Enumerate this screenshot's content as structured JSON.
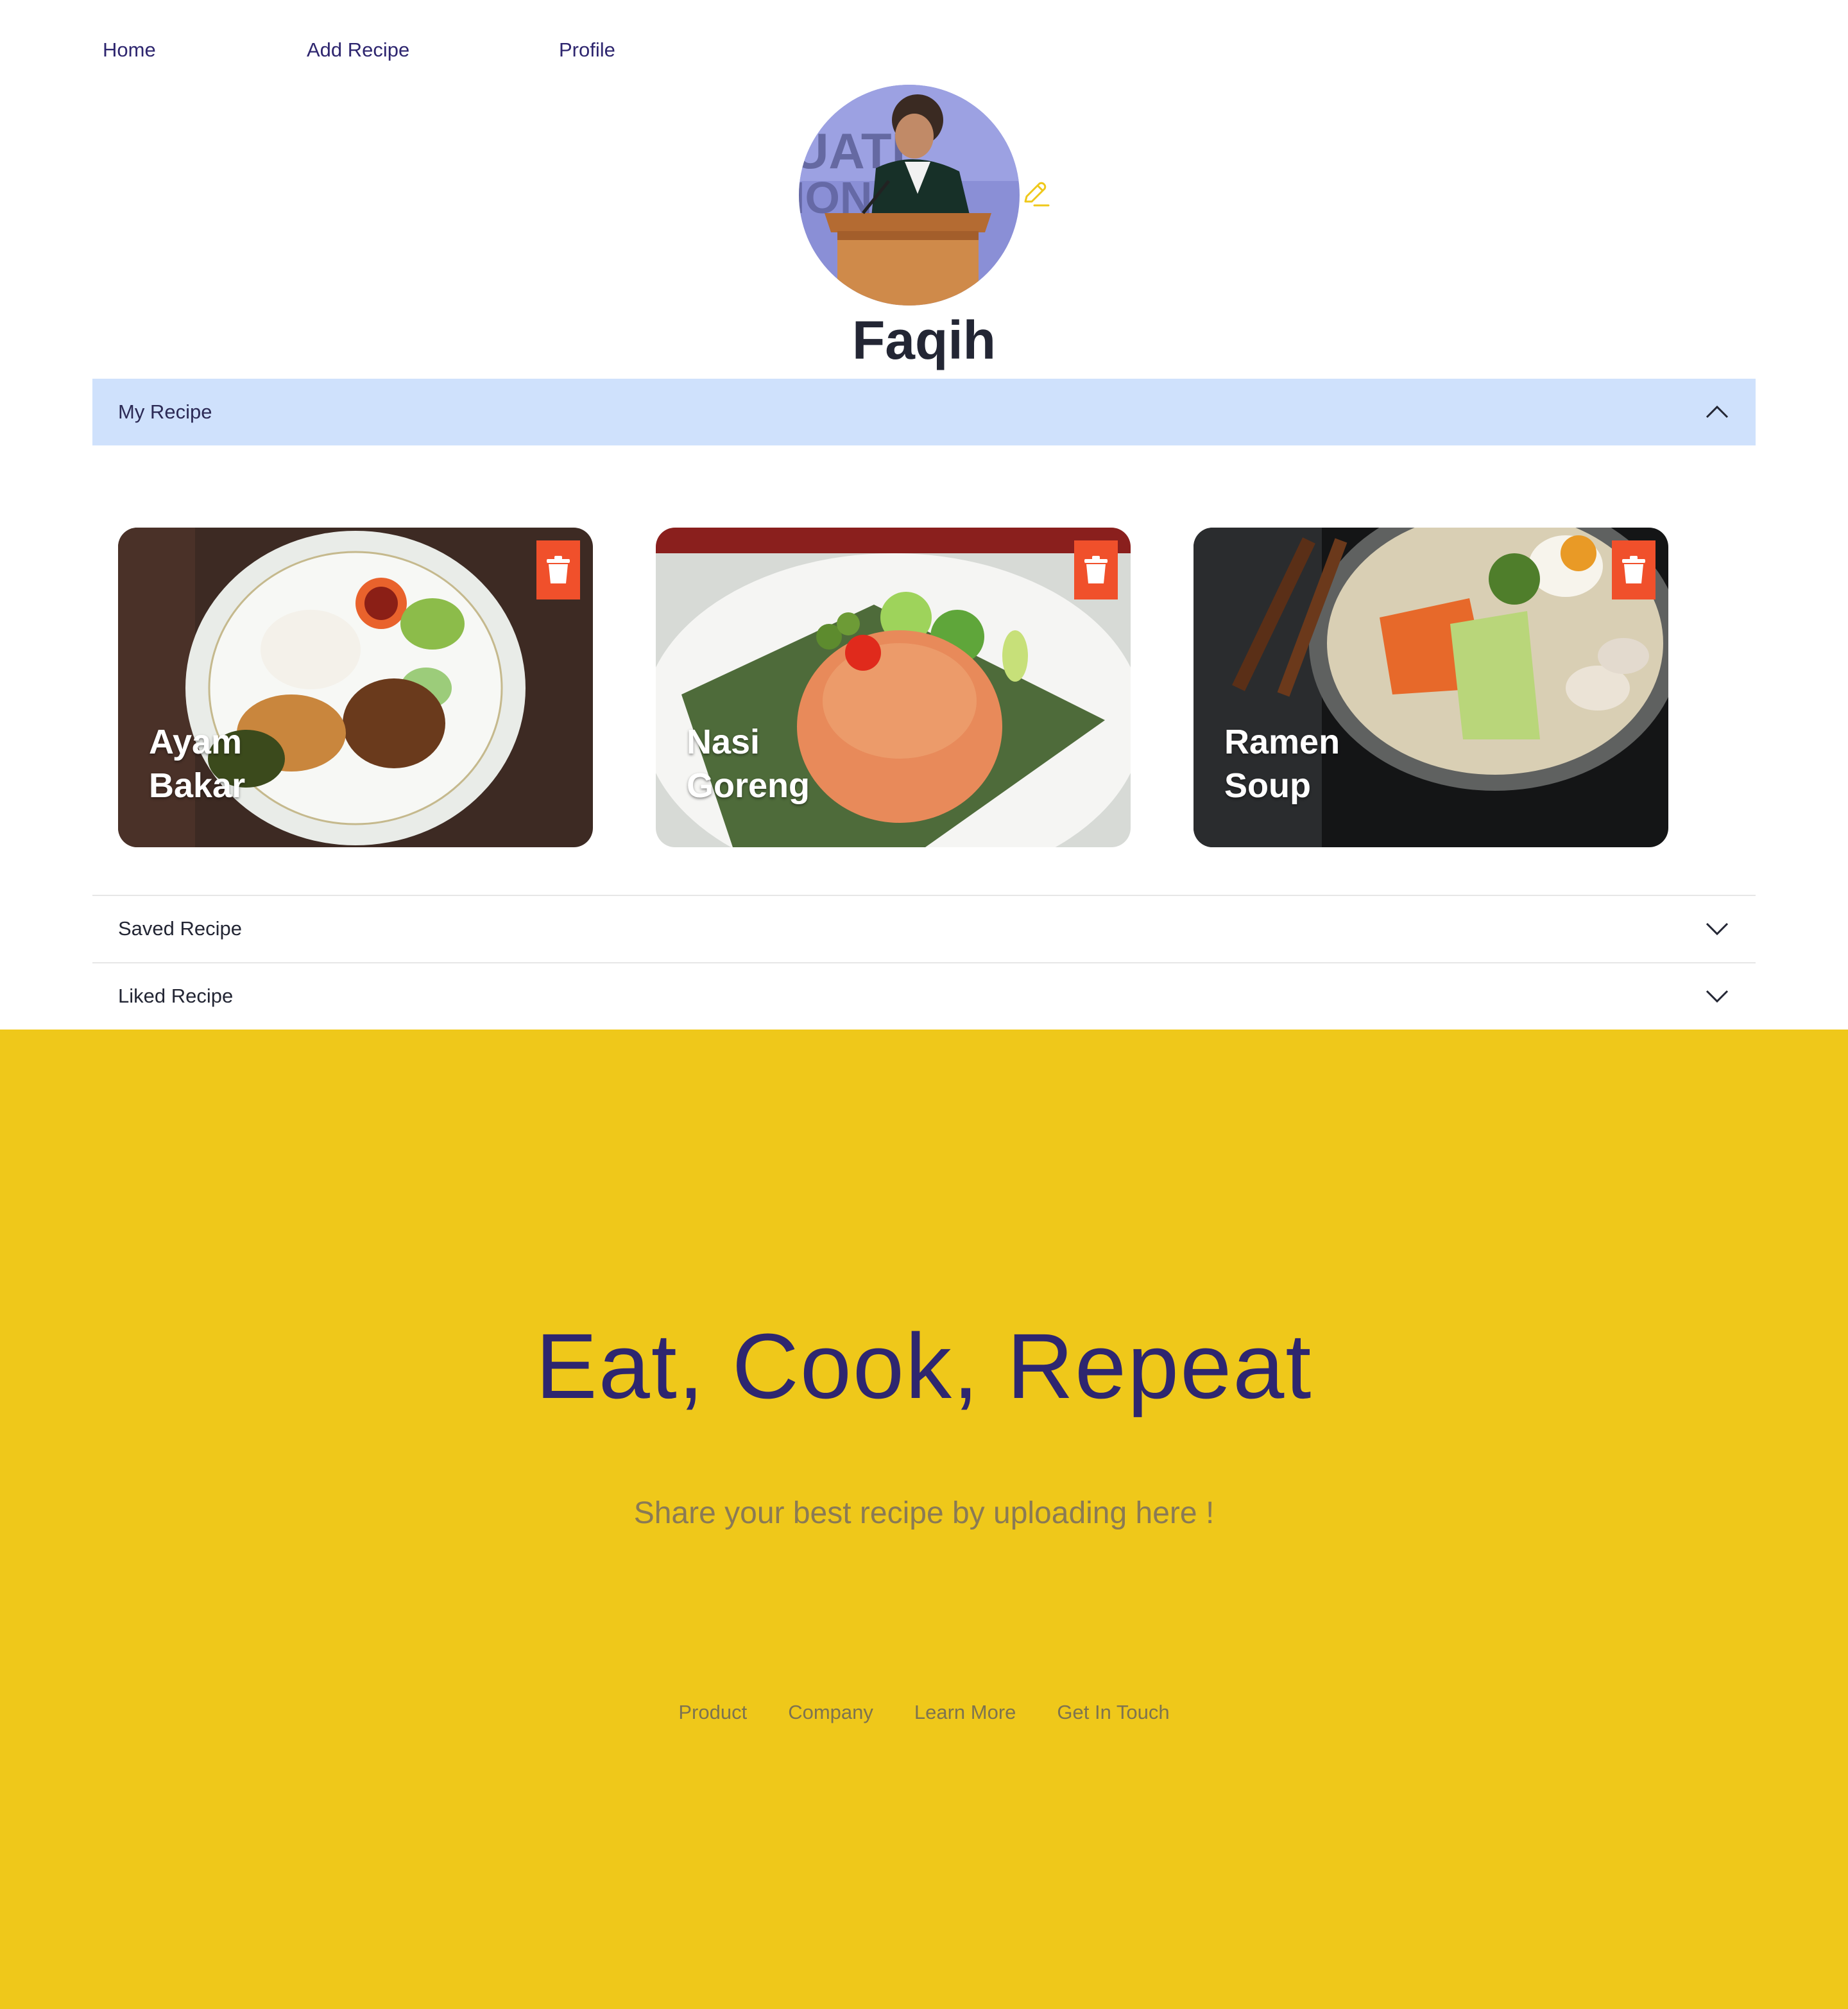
{
  "nav": {
    "home": "Home",
    "add_recipe": "Add Recipe",
    "profile": "Profile"
  },
  "profile": {
    "name": "Faqih",
    "avatar_icon": "user-photo",
    "edit_icon": "pencil-icon"
  },
  "accordion": {
    "my_recipe": {
      "label": "My Recipe",
      "expanded": true
    },
    "saved_recipe": {
      "label": "Saved Recipe",
      "expanded": false
    },
    "liked_recipe": {
      "label": "Liked Recipe",
      "expanded": false
    }
  },
  "recipes": [
    {
      "title_line1": "Ayam",
      "title_line2": "Bakar",
      "action_icon": "trash-icon"
    },
    {
      "title_line1": "Nasi",
      "title_line2": "Goreng",
      "action_icon": "trash-icon"
    },
    {
      "title_line1": "Ramen",
      "title_line2": "Soup",
      "action_icon": "trash-icon"
    }
  ],
  "footer": {
    "tagline": "Eat, Cook, Repeat",
    "subtitle": "Share your best recipe by uploading here !",
    "links": [
      "Product",
      "Company",
      "Learn More",
      "Get In Touch"
    ]
  },
  "colors": {
    "accent_yellow": "#efc81a",
    "accordion_active_bg": "#cfe1fc",
    "delete_red": "#f0502b",
    "nav_text": "#2e266f"
  }
}
